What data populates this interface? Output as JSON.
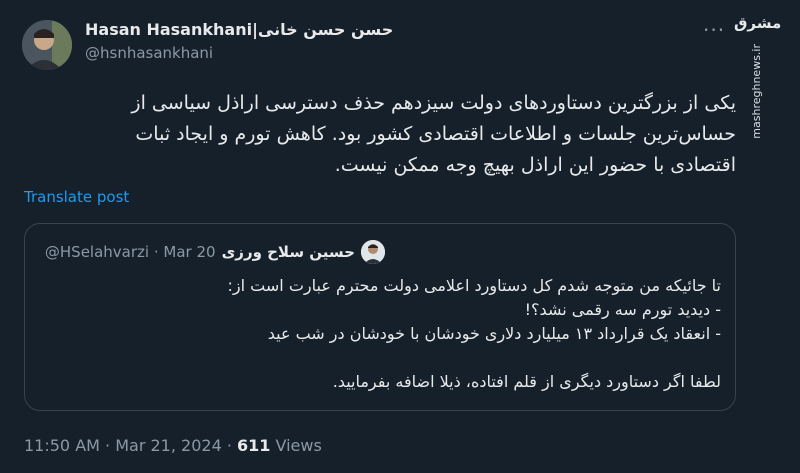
{
  "author": {
    "name": "Hasan Hasankhani|حسن حسن خانی",
    "handle": "@hsnhasankhani"
  },
  "more_icon": "ellipsis-icon",
  "watermark": {
    "logo": "مشرق",
    "url": "mashreghnews.ir"
  },
  "tweet": {
    "lines": [
      "یکی از بزرگترین دستاوردهای دولت سیزدهم حذف دسترسی اراذل سیاسی از",
      "حساس‌ترین جلسات و اطلاعات اقتصادی کشور بود. کاهش تورم و ایجاد ثبات",
      "اقتصادی با حضور این اراذل بهیچ وجه ممکن نیست."
    ],
    "translate_label": "Translate post"
  },
  "quote": {
    "name": "حسین سلاح ورزی",
    "handle": "@HSelahvarzi",
    "date": "Mar 20",
    "lines": [
      "تا جائیکه من متوجه شدم کل دستاورد اعلامی دولت محترم عبارت است از:",
      "- دیدید تورم سه رقمی نشد؟!",
      "- انعقاد یک قرارداد ۱۳ میلیارد دلاری خودشان با خودشان در شب عید",
      "",
      "لطفا اگر دستاورد دیگری از قلم افتاده، ذیلا اضافه بفرمایید."
    ]
  },
  "footer": {
    "time": "11:50 AM",
    "date": "Mar 21, 2024",
    "views_count": "611",
    "views_label": "Views"
  }
}
